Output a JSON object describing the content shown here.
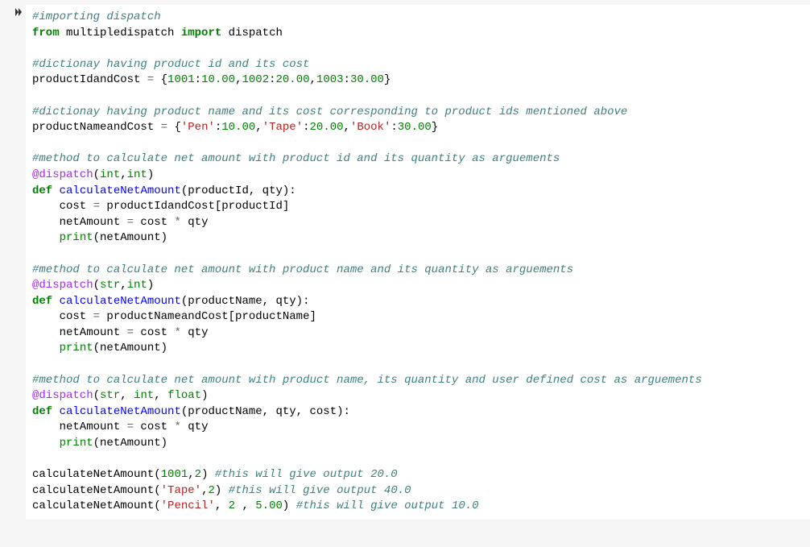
{
  "prompt_icon": "run-cell-icon",
  "code": {
    "lines": [
      [
        {
          "cls": "c-comment",
          "t": "#importing dispatch"
        }
      ],
      [
        {
          "cls": "c-keyword",
          "t": "from"
        },
        {
          "cls": "c-text",
          "t": " multipledispatch "
        },
        {
          "cls": "c-keyword",
          "t": "import"
        },
        {
          "cls": "c-text",
          "t": " dispatch"
        }
      ],
      [],
      [
        {
          "cls": "c-comment",
          "t": "#dictionay having product id and its cost"
        }
      ],
      [
        {
          "cls": "c-text",
          "t": "productIdandCost "
        },
        {
          "cls": "c-op",
          "t": "="
        },
        {
          "cls": "c-text",
          "t": " {"
        },
        {
          "cls": "c-number",
          "t": "1001"
        },
        {
          "cls": "c-text",
          "t": ":"
        },
        {
          "cls": "c-number",
          "t": "10.00"
        },
        {
          "cls": "c-text",
          "t": ","
        },
        {
          "cls": "c-number",
          "t": "1002"
        },
        {
          "cls": "c-text",
          "t": ":"
        },
        {
          "cls": "c-number",
          "t": "20.00"
        },
        {
          "cls": "c-text",
          "t": ","
        },
        {
          "cls": "c-number",
          "t": "1003"
        },
        {
          "cls": "c-text",
          "t": ":"
        },
        {
          "cls": "c-number",
          "t": "30.00"
        },
        {
          "cls": "c-text",
          "t": "}"
        }
      ],
      [],
      [
        {
          "cls": "c-comment",
          "t": "#dictionay having product name and its cost corresponding to product ids mentioned above"
        }
      ],
      [
        {
          "cls": "c-text",
          "t": "productNameandCost "
        },
        {
          "cls": "c-op",
          "t": "="
        },
        {
          "cls": "c-text",
          "t": " {"
        },
        {
          "cls": "c-string",
          "t": "'Pen'"
        },
        {
          "cls": "c-text",
          "t": ":"
        },
        {
          "cls": "c-number",
          "t": "10.00"
        },
        {
          "cls": "c-text",
          "t": ","
        },
        {
          "cls": "c-string",
          "t": "'Tape'"
        },
        {
          "cls": "c-text",
          "t": ":"
        },
        {
          "cls": "c-number",
          "t": "20.00"
        },
        {
          "cls": "c-text",
          "t": ","
        },
        {
          "cls": "c-string",
          "t": "'Book'"
        },
        {
          "cls": "c-text",
          "t": ":"
        },
        {
          "cls": "c-number",
          "t": "30.00"
        },
        {
          "cls": "c-text",
          "t": "}"
        }
      ],
      [],
      [
        {
          "cls": "c-comment",
          "t": "#method to calculate net amount with product id and its quantity as arguements"
        }
      ],
      [
        {
          "cls": "c-decor",
          "t": "@dispatch"
        },
        {
          "cls": "c-text",
          "t": "("
        },
        {
          "cls": "c-builtin",
          "t": "int"
        },
        {
          "cls": "c-text",
          "t": ","
        },
        {
          "cls": "c-builtin",
          "t": "int"
        },
        {
          "cls": "c-text",
          "t": ")"
        }
      ],
      [
        {
          "cls": "c-keyword",
          "t": "def"
        },
        {
          "cls": "c-text",
          "t": " "
        },
        {
          "cls": "c-def",
          "t": "calculateNetAmount"
        },
        {
          "cls": "c-text",
          "t": "(productId, qty):"
        }
      ],
      [
        {
          "cls": "c-text",
          "t": "    cost "
        },
        {
          "cls": "c-op",
          "t": "="
        },
        {
          "cls": "c-text",
          "t": " productIdandCost[productId]"
        }
      ],
      [
        {
          "cls": "c-text",
          "t": "    netAmount "
        },
        {
          "cls": "c-op",
          "t": "="
        },
        {
          "cls": "c-text",
          "t": " cost "
        },
        {
          "cls": "c-op",
          "t": "*"
        },
        {
          "cls": "c-text",
          "t": " qty"
        }
      ],
      [
        {
          "cls": "c-text",
          "t": "    "
        },
        {
          "cls": "c-builtin",
          "t": "print"
        },
        {
          "cls": "c-text",
          "t": "(netAmount)"
        }
      ],
      [],
      [
        {
          "cls": "c-comment",
          "t": "#method to calculate net amount with product name and its quantity as arguements"
        }
      ],
      [
        {
          "cls": "c-decor",
          "t": "@dispatch"
        },
        {
          "cls": "c-text",
          "t": "("
        },
        {
          "cls": "c-builtin",
          "t": "str"
        },
        {
          "cls": "c-text",
          "t": ","
        },
        {
          "cls": "c-builtin",
          "t": "int"
        },
        {
          "cls": "c-text",
          "t": ")"
        }
      ],
      [
        {
          "cls": "c-keyword",
          "t": "def"
        },
        {
          "cls": "c-text",
          "t": " "
        },
        {
          "cls": "c-def",
          "t": "calculateNetAmount"
        },
        {
          "cls": "c-text",
          "t": "(productName, qty):"
        }
      ],
      [
        {
          "cls": "c-text",
          "t": "    cost "
        },
        {
          "cls": "c-op",
          "t": "="
        },
        {
          "cls": "c-text",
          "t": " productNameandCost[productName]"
        }
      ],
      [
        {
          "cls": "c-text",
          "t": "    netAmount "
        },
        {
          "cls": "c-op",
          "t": "="
        },
        {
          "cls": "c-text",
          "t": " cost "
        },
        {
          "cls": "c-op",
          "t": "*"
        },
        {
          "cls": "c-text",
          "t": " qty"
        }
      ],
      [
        {
          "cls": "c-text",
          "t": "    "
        },
        {
          "cls": "c-builtin",
          "t": "print"
        },
        {
          "cls": "c-text",
          "t": "(netAmount)"
        }
      ],
      [],
      [
        {
          "cls": "c-comment",
          "t": "#method to calculate net amount with product name, its quantity and user defined cost as arguements"
        }
      ],
      [
        {
          "cls": "c-decor",
          "t": "@dispatch"
        },
        {
          "cls": "c-text",
          "t": "("
        },
        {
          "cls": "c-builtin",
          "t": "str"
        },
        {
          "cls": "c-text",
          "t": ", "
        },
        {
          "cls": "c-builtin",
          "t": "int"
        },
        {
          "cls": "c-text",
          "t": ", "
        },
        {
          "cls": "c-builtin",
          "t": "float"
        },
        {
          "cls": "c-text",
          "t": ")"
        }
      ],
      [
        {
          "cls": "c-keyword",
          "t": "def"
        },
        {
          "cls": "c-text",
          "t": " "
        },
        {
          "cls": "c-def",
          "t": "calculateNetAmount"
        },
        {
          "cls": "c-text",
          "t": "(productName, qty, cost):"
        }
      ],
      [
        {
          "cls": "c-text",
          "t": "    netAmount "
        },
        {
          "cls": "c-op",
          "t": "="
        },
        {
          "cls": "c-text",
          "t": " cost "
        },
        {
          "cls": "c-op",
          "t": "*"
        },
        {
          "cls": "c-text",
          "t": " qty"
        }
      ],
      [
        {
          "cls": "c-text",
          "t": "    "
        },
        {
          "cls": "c-builtin",
          "t": "print"
        },
        {
          "cls": "c-text",
          "t": "(netAmount)"
        }
      ],
      [],
      [
        {
          "cls": "c-text",
          "t": "calculateNetAmount("
        },
        {
          "cls": "c-number",
          "t": "1001"
        },
        {
          "cls": "c-text",
          "t": ","
        },
        {
          "cls": "c-number",
          "t": "2"
        },
        {
          "cls": "c-text",
          "t": ") "
        },
        {
          "cls": "c-comment",
          "t": "#this will give output 20.0"
        }
      ],
      [
        {
          "cls": "c-text",
          "t": "calculateNetAmount("
        },
        {
          "cls": "c-string",
          "t": "'Tape'"
        },
        {
          "cls": "c-text",
          "t": ","
        },
        {
          "cls": "c-number",
          "t": "2"
        },
        {
          "cls": "c-text",
          "t": ") "
        },
        {
          "cls": "c-comment",
          "t": "#this will give output 40.0"
        }
      ],
      [
        {
          "cls": "c-text",
          "t": "calculateNetAmount("
        },
        {
          "cls": "c-string",
          "t": "'Pencil'"
        },
        {
          "cls": "c-text",
          "t": ", "
        },
        {
          "cls": "c-number",
          "t": "2"
        },
        {
          "cls": "c-text",
          "t": " , "
        },
        {
          "cls": "c-number",
          "t": "5.00"
        },
        {
          "cls": "c-text",
          "t": ") "
        },
        {
          "cls": "c-comment",
          "t": "#this will give output 10.0"
        }
      ]
    ]
  }
}
